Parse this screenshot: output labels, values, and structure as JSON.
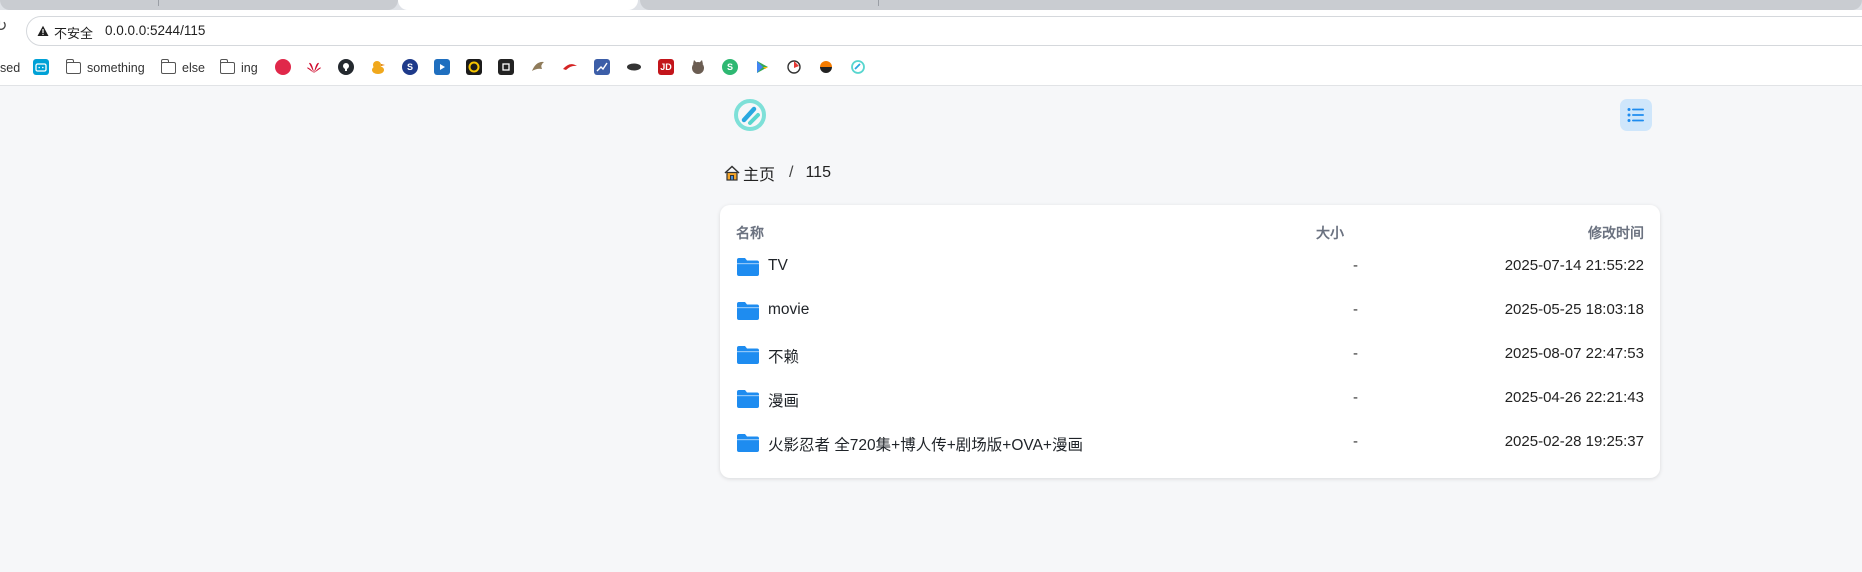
{
  "browser": {
    "security_label": "不安全",
    "url": "0.0.0.0:5244/115"
  },
  "bookmarks": {
    "items": [
      {
        "label": "sed"
      },
      {
        "label": "something"
      },
      {
        "label": "else"
      },
      {
        "label": "ing"
      }
    ],
    "icons": [
      {
        "name": "bilibili-icon",
        "color": "#00a1d6"
      },
      {
        "name": "octopus-icon",
        "color": "#e0284a"
      },
      {
        "name": "huawei-icon",
        "color": "#cf0a2c"
      },
      {
        "name": "github-icon",
        "color": "#24292f"
      },
      {
        "name": "duck-icon",
        "color": "#f0a81c"
      },
      {
        "name": "s-circle-icon",
        "color": "#1e3a8a"
      },
      {
        "name": "play-square-icon",
        "color": "#1f6fbf"
      },
      {
        "name": "yellow-logo-icon",
        "color": "#1b1b1b"
      },
      {
        "name": "box-logo-icon",
        "color": "#222222"
      },
      {
        "name": "bird-icon",
        "color": "#8f7b5a"
      },
      {
        "name": "red-swoosh-icon",
        "color": "#d42323"
      },
      {
        "name": "chart-icon",
        "color": "#3c5ea8"
      },
      {
        "name": "ellipse-icon",
        "color": "#333333"
      },
      {
        "name": "jd-icon",
        "color": "#c3151b"
      },
      {
        "name": "cat-icon",
        "color": "#6b5d52"
      },
      {
        "name": "green-s-icon",
        "color": "#2eb872"
      },
      {
        "name": "google-play-icon",
        "color": "#34a853"
      },
      {
        "name": "rocket-icon",
        "color": "#e53935"
      },
      {
        "name": "half-circle-icon",
        "color": "#f57c00"
      },
      {
        "name": "teal-logo-icon",
        "color": "#58d6cf"
      }
    ]
  },
  "header": {
    "logo_icon": "app-logo-icon",
    "menu_icon": "list-icon"
  },
  "breadcrumb": {
    "home": "主页",
    "separator": "/",
    "current": "115"
  },
  "table": {
    "headers": {
      "name": "名称",
      "size": "大小",
      "modified": "修改时间"
    },
    "rows": [
      {
        "name": "TV",
        "size": "-",
        "modified": "2025-07-14 21:55:22"
      },
      {
        "name": "movie",
        "size": "-",
        "modified": "2025-05-25 18:03:18"
      },
      {
        "name": "不赖",
        "size": "-",
        "modified": "2025-08-07 22:47:53"
      },
      {
        "name": "漫画",
        "size": "-",
        "modified": "2025-04-26 22:21:43"
      },
      {
        "name": "火影忍者 全720集+博人传+剧场版+OVA+漫画",
        "size": "-",
        "modified": "2025-02-28 19:25:37"
      }
    ]
  },
  "colors": {
    "folder": "#1e8cf0",
    "accent": "#1e8cf0",
    "menu_bg": "#cfe6fb",
    "logo": "#5fd6cf"
  }
}
